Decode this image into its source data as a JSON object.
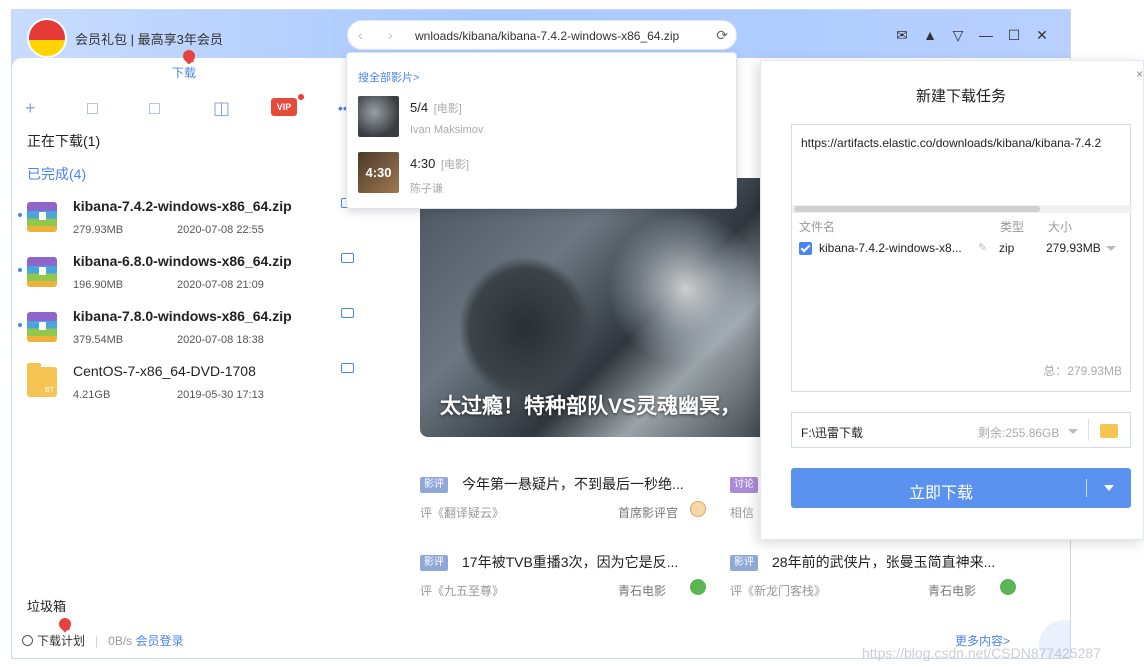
{
  "titlebar": {
    "member_text": "会员礼包 | 最高享3年会员",
    "url": "wnloads/kibana/kibana-7.4.2-windows-x86_64.zip"
  },
  "sidebar": {
    "tab_label": "下载",
    "downloading": "正在下载(1)",
    "completed": "已完成(4)",
    "vip_label": "VIP",
    "files": [
      {
        "name": "kibana-7.4.2-windows-x86_64.zip",
        "size": "279.93MB",
        "date": "2020-07-08 22:55"
      },
      {
        "name": "kibana-6.8.0-windows-x86_64.zip",
        "size": "196.90MB",
        "date": "2020-07-08 21:09"
      },
      {
        "name": "kibana-7.8.0-windows-x86_64.zip",
        "size": "379.54MB",
        "date": "2020-07-08 18:38"
      },
      {
        "name": "CentOS-7-x86_64-DVD-1708",
        "size": "4.21GB",
        "date": "2019-05-30 17:13"
      }
    ],
    "trash": "垃圾箱",
    "footer": {
      "plan": "下载计划",
      "speed": "0B/s",
      "login": "会员登录"
    }
  },
  "dropdown": {
    "search_all": "搜全部影片>",
    "items": [
      {
        "title": "5/4",
        "category": "[电影]",
        "person": "Ivan Maksimov",
        "thumb": ""
      },
      {
        "title": "4:30",
        "category": "[电影]",
        "person": "陈子谦",
        "thumb": "4:30"
      }
    ]
  },
  "content": {
    "hero_title": "太过瘾！特种部队VS灵魂幽冥，",
    "cards": [
      {
        "tag": "影评",
        "headline": "今年第一悬疑片，不到最后一秒绝...",
        "sub": "评《翻译疑云》",
        "source": "首席影评官"
      },
      {
        "tag": "讨论",
        "headline": "",
        "sub": "相信",
        "source": ""
      },
      {
        "tag": "影评",
        "headline": "17年被TVB重播3次，因为它是反...",
        "sub": "评《九五至尊》",
        "source": "青石电影"
      },
      {
        "tag": "影评",
        "headline": "28年前的武侠片，张曼玉简直神来...",
        "sub": "评《新龙门客栈》",
        "source": "青石电影"
      }
    ],
    "more": "更多内容>"
  },
  "panel": {
    "title": "新建下载任务",
    "link": "https://artifacts.elastic.co/downloads/kibana/kibana-7.4.2",
    "col_name": "文件名",
    "col_type": "类型",
    "col_size": "大小",
    "file_name": "kibana-7.4.2-windows-x8...",
    "file_type": "zip",
    "file_size": "279.93MB",
    "total": "总：279.93MB",
    "path": "F:\\迅雷下载",
    "free": "剩余:255.86GB",
    "download_btn": "立即下载"
  },
  "watermark": "https://blog.csdn.net/CSDN877425287"
}
